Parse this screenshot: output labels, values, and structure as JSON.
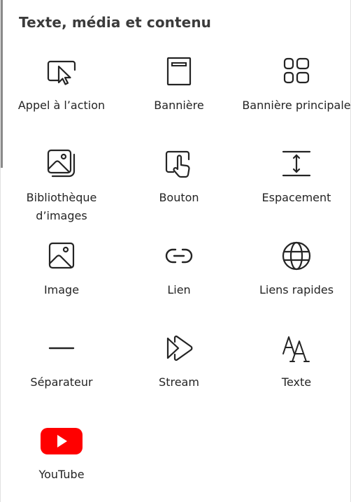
{
  "section": {
    "title": "Texte, média et contenu"
  },
  "items": [
    {
      "label": "Appel à l’action",
      "icon": "call-to-action-icon"
    },
    {
      "label": "Bannière",
      "icon": "banner-icon"
    },
    {
      "label": "Bannière principale",
      "icon": "hero-banner-icon"
    },
    {
      "label": "Bibliothèque d’images",
      "icon": "image-gallery-icon"
    },
    {
      "label": "Bouton",
      "icon": "button-icon"
    },
    {
      "label": "Espacement",
      "icon": "spacer-icon"
    },
    {
      "label": "Image",
      "icon": "image-icon"
    },
    {
      "label": "Lien",
      "icon": "link-icon"
    },
    {
      "label": "Liens rapides",
      "icon": "globe-icon"
    },
    {
      "label": "Séparateur",
      "icon": "divider-icon"
    },
    {
      "label": "Stream",
      "icon": "stream-icon"
    },
    {
      "label": "Texte",
      "icon": "text-icon"
    },
    {
      "label": "YouTube",
      "icon": "youtube-icon"
    }
  ],
  "colors": {
    "youtube_red": "#ff0000",
    "text": "#242424",
    "title": "#3b3b3b"
  }
}
